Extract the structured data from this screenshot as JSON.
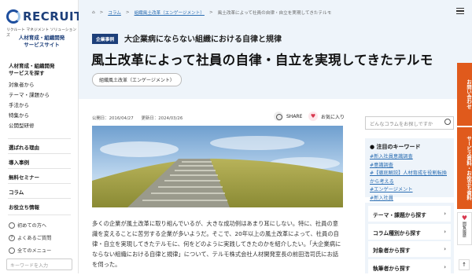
{
  "brand": {
    "logo": "RECRUIT",
    "logo_sub": "リクルート マネジメント ソリューションズ",
    "site_name": "人材育成・組織開発\nサービスサイト"
  },
  "sidebar": {
    "group_head": "人材育成・組織開発\nサービスを探す",
    "items": [
      "対象者から",
      "テーマ・課題から",
      "手法から",
      "特集から",
      "公開型研修"
    ],
    "bold_links": [
      "選ばれる理由",
      "導入事例",
      "無料セミナー",
      "コラム",
      "お役立ち情報"
    ],
    "small_links": [
      "初めての方へ",
      "よくあるご質問",
      "全てのメニュー"
    ],
    "search_placeholder": "キーワードを入力"
  },
  "breadcrumb": [
    "コラム",
    "組織風土改革（エンゲージメント）",
    "風土改革によって社員の自律・自立を実現してきたテルモ"
  ],
  "header": {
    "category": "企業事例",
    "series": "大企業病にならない組織における自律と規律",
    "title": "風土改革によって社員の自律・自立を実現してきたテルモ",
    "tag": "組織風土改革（エンゲージメント）"
  },
  "meta": {
    "published": "公開日：2016/04/27",
    "updated": "更新日：2024/03/26",
    "share": "SHARE",
    "favorite": "お気に入り"
  },
  "body": "多くの企業が風土改革に取り組んでいるが、大きな成功例はあまり耳にしない。特に、社員の意識を変えることに苦労する企業が多いようだ。そこで、20年以上の風土改革によって、社員の自律・自立を実現してきたテルモに、何をどのように実践してきたのかを紹介したい。「大企業病にならない組織における自律と規律」について、テルモ株式会社人材開発室長の前田浩司氏にお話を伺った。",
  "right": {
    "search_placeholder": "どんなコラムをお探しですか",
    "keywords_head": "注目のキーワード",
    "keywords": [
      "#新入社員意識調査",
      "#意識調査",
      "#【徹底解説】人材育成を役割転換から考える",
      "#エンゲージメント",
      "#新入社員"
    ],
    "nav": [
      "テーマ・課題から探す",
      "コラム種別から探す",
      "対象者から探す",
      "執筆者から探す"
    ]
  },
  "float_tabs": {
    "tab1": "お問い合わせ",
    "tab2": "サービス資料・お役立ち資料",
    "tab3": "閲覧履歴"
  },
  "colors": {
    "brand": "#1d3f7a",
    "accent": "#e05a1c",
    "band": "#eef4fa",
    "link": "#2a6db2"
  }
}
